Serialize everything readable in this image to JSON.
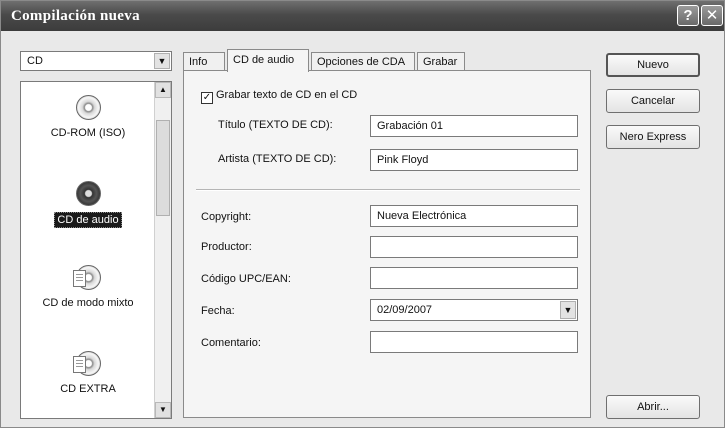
{
  "window": {
    "title": "Compilación nueva",
    "help_glyph": "?",
    "close_glyph": "✕"
  },
  "left": {
    "type_combo": {
      "value": "CD"
    },
    "items": [
      {
        "label": "CD-ROM (ISO)",
        "icon": "cdrom-iso-icon"
      },
      {
        "label": "CD de audio",
        "icon": "audio-cd-icon",
        "selected": true
      },
      {
        "label": "CD de modo mixto",
        "icon": "mixed-mode-cd-icon"
      },
      {
        "label": "CD EXTRA",
        "icon": "cd-extra-icon"
      }
    ]
  },
  "tabs": [
    {
      "label": "Info"
    },
    {
      "label": "CD de audio",
      "active": true
    },
    {
      "label": "Opciones de CDA"
    },
    {
      "label": "Grabar"
    }
  ],
  "panel": {
    "write_cdtext": {
      "label": "Grabar texto de CD en el CD",
      "checked": true
    },
    "title_field": {
      "label": "Título (TEXTO DE CD):",
      "value": "Grabación 01"
    },
    "artist_field": {
      "label": "Artista (TEXTO DE CD):",
      "value": "Pink Floyd"
    },
    "copyright_field": {
      "label": "Copyright:",
      "value": "Nueva Electrónica"
    },
    "producer_field": {
      "label": "Productor:",
      "value": ""
    },
    "upc_field": {
      "label": "Código UPC/EAN:",
      "value": ""
    },
    "date_field": {
      "label": "Fecha:",
      "value": "02/09/2007"
    },
    "comment_field": {
      "label": "Comentario:",
      "value": ""
    }
  },
  "buttons": {
    "new": "Nuevo",
    "cancel": "Cancelar",
    "nero_express": "Nero Express",
    "open": "Abrir..."
  }
}
